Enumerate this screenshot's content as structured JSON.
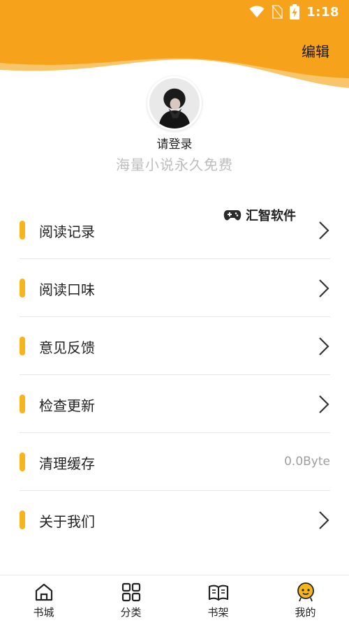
{
  "status_bar": {
    "time": "1:18",
    "icons": [
      "wifi-icon",
      "no-sim-icon",
      "battery-charging-icon"
    ]
  },
  "header": {
    "edit_label": "编辑",
    "login_label": "请登录",
    "slogan": "海量小说永久免费"
  },
  "watermark": {
    "text": "汇智软件",
    "icon": "gamepad-icon"
  },
  "menu": {
    "items": [
      {
        "label": "阅读记录"
      },
      {
        "label": "阅读口味"
      },
      {
        "label": "意见反馈"
      },
      {
        "label": "检查更新"
      },
      {
        "label": "清理缓存",
        "value": "0.0Byte"
      },
      {
        "label": "关于我们"
      }
    ]
  },
  "tabbar": {
    "tabs": [
      {
        "label": "书城",
        "icon": "home-icon"
      },
      {
        "label": "分类",
        "icon": "grid-icon"
      },
      {
        "label": "书架",
        "icon": "open-book-icon"
      },
      {
        "label": "我的",
        "icon": "user-mascot-icon",
        "active": true
      }
    ]
  },
  "colors": {
    "header_orange": "#f7a21b",
    "accent": "#f7b51c"
  }
}
